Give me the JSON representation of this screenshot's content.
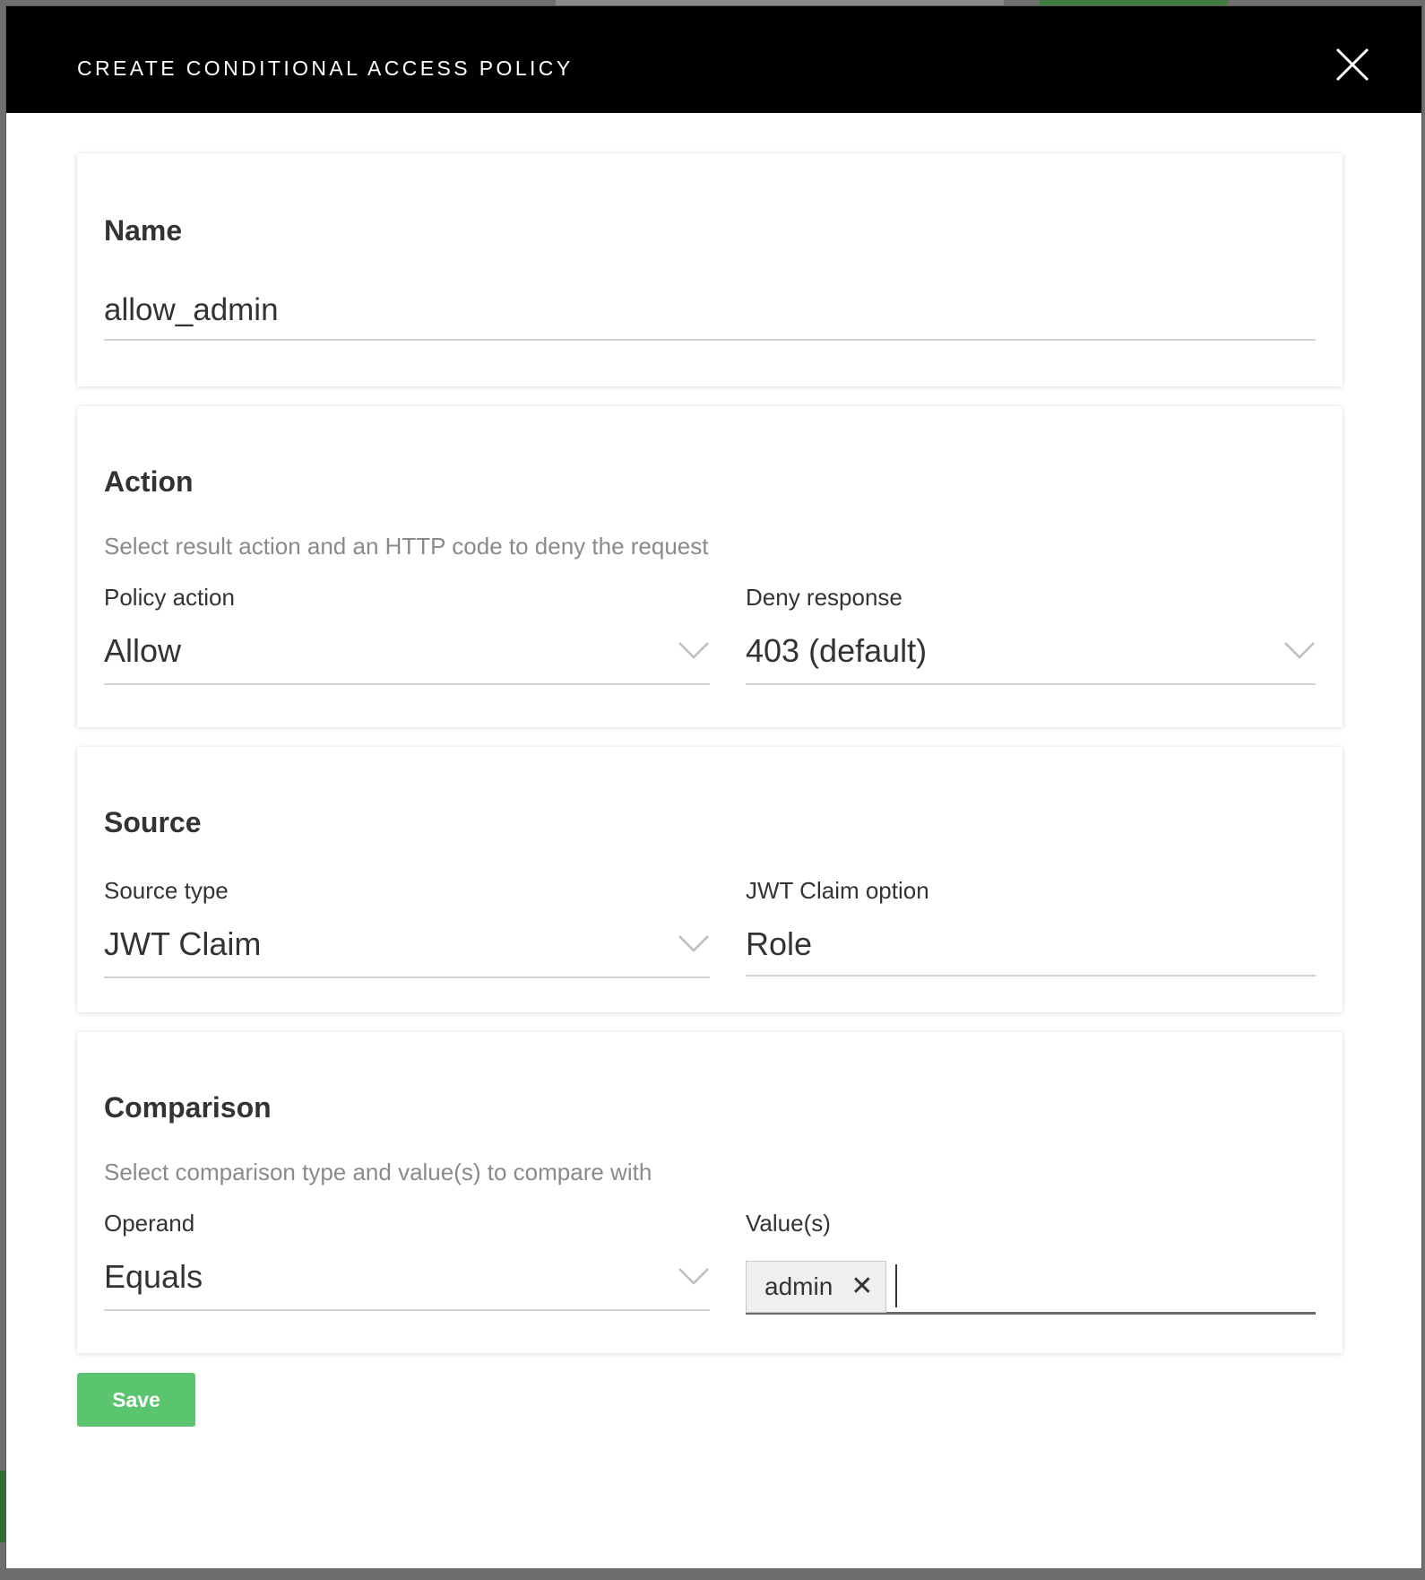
{
  "modal": {
    "title": "CREATE CONDITIONAL ACCESS POLICY",
    "close_icon": "close-icon"
  },
  "name_section": {
    "title": "Name",
    "value": "allow_admin"
  },
  "action_section": {
    "title": "Action",
    "description": "Select result action and an HTTP code to deny the request",
    "policy_action": {
      "label": "Policy action",
      "value": "Allow"
    },
    "deny_response": {
      "label": "Deny response",
      "value": "403 (default)"
    }
  },
  "source_section": {
    "title": "Source",
    "source_type": {
      "label": "Source type",
      "value": "JWT Claim"
    },
    "jwt_claim_option": {
      "label": "JWT Claim option",
      "value": "Role"
    }
  },
  "comparison_section": {
    "title": "Comparison",
    "description": "Select comparison type and value(s) to compare with",
    "operand": {
      "label": "Operand",
      "value": "Equals"
    },
    "values": {
      "label": "Value(s)",
      "tags": [
        "admin"
      ],
      "remove_glyph": "✕"
    }
  },
  "save_label": "Save",
  "colors": {
    "header_bg": "#000000",
    "save_button": "#5ac46e",
    "muted_text": "#8a8a8a"
  }
}
